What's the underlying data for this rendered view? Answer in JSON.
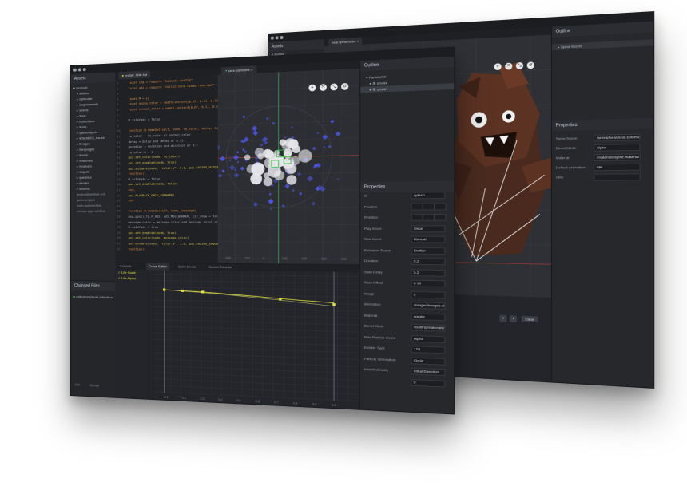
{
  "back_window": {
    "assets_title": "Assets",
    "tree": [
      "▾ /builtins"
    ],
    "tab": "bear.spinemodel",
    "outline_title": "Outline",
    "outline_item": "Spine Model",
    "properties_title": "Properties",
    "props": [
      {
        "label": "Spine Scene",
        "value": "/anims/bear/bear.spinescene"
      },
      {
        "label": "Blend Mode",
        "value": "Alpha"
      },
      {
        "label": "Material",
        "value": "/materials/spine.material"
      },
      {
        "label": "Default Animation",
        "value": "idle"
      },
      {
        "label": "Skin",
        "value": ""
      }
    ],
    "clear_label": "Clear"
  },
  "front_window": {
    "assets_title": "Assets",
    "tree": [
      "▾ /android",
      "▾ /builtins",
      "▸ /defender",
      "▸ /engineassets",
      "▸ /anims",
      "▸ /bear",
      "▸ /collections",
      "▸ /fonts",
      "▸ /gameobjects",
      "▸ /ENEMIES_house",
      "▸ /images",
      "▸ /languages",
      "▸ /levels",
      "▸ /materials",
      "▸ /modules",
      "▸ /objects",
      "▸ /particles",
      "▸ /render",
      "▸ /sounds",
      "AndroidManifest.xml",
      "game.project",
      "main.appmanifest",
      "release.appmanifest"
    ],
    "changed_files_title": "Changed Files",
    "changed_file": "collections/level.collection",
    "diff_label": "Diff",
    "revert_label": "Revert",
    "code_tab": "restart_hide.lua",
    "particle_tab": "take.particlefx",
    "code_lines": [
      "local cfg = require \"modules.config\"",
      "local ads = require \"collections.loader.ads.api\"",
      "",
      "local M = {}",
      "local alpha_color = vmath.vector4(0.67, 0.11, 0.12, 1)",
      "local normal_color = vmath.vector4(0.67, 0.11, 0.12, 1)",
      "",
      "M.isInFade = false",
      "",
      "function M.fadeOut(self, node, to_color, delay, duration)",
      "  to_color = to_color or normal_color",
      "  delay = delay and delay or 0.15",
      "  duration = duration and duration or 0.1",
      "  to_color.w = 1",
      "  gui.set_color(node, to_color)",
      "  gui.set_enabled(node, true)",
      "  gui.animate(node, \"color.w\", 0.0, gui.EASING_OUTQUAD,",
      "    function()",
      "      M.isInFade = false",
      "      gui.set_enabled(node, false)",
      "    end,",
      "  gui.PLAYBACK_ONCE_FORWARD)",
      "end",
      "",
      "function M.fadeIn(self, node, message)",
      "  msg.post(cfg.P_ADS, ads.MSG_BANNER, {is_show = false})",
      "  message.color = message.color and message.color or normal_color",
      "  M.isInFade = true",
      "  gui.set_enabled(node, true)",
      "  gui.set_color(node, message.color)",
      "  gui.animate(node, \"color.w\", 1.0, gui.EASING_INQUAD,",
      "    function()"
    ],
    "outline_title": "Outline",
    "outline_items": [
      "▾ ParticleFX",
      "▸ ⊞ smoke",
      "▸ ⊞ splash"
    ],
    "properties_title": "Properties",
    "props": [
      {
        "label": "Id",
        "value": "splash"
      },
      {
        "label": "Position",
        "value": ""
      },
      {
        "label": "Rotation",
        "value": ""
      },
      {
        "label": "Play Mode",
        "value": "Once"
      },
      {
        "label": "Size Mode",
        "value": "Manual"
      },
      {
        "label": "Emission Space",
        "value": "Emitter"
      },
      {
        "label": "Duration",
        "value": "0.2"
      },
      {
        "label": "Start Delay",
        "value": "0.2"
      },
      {
        "label": "Start Offset",
        "value": "0.15"
      },
      {
        "label": "Image",
        "value": "0"
      },
      {
        "label": "Animation",
        "value": "/images/images.atlas"
      },
      {
        "label": "Material",
        "value": "smoke"
      },
      {
        "label": "Blend Mode",
        "value": "/builtins/materials/particlefx.material"
      },
      {
        "label": "Max Particle Count",
        "value": "Alpha"
      },
      {
        "label": "Emitter Type",
        "value": "128"
      },
      {
        "label": "Particle Orientation",
        "value": "Circle"
      },
      {
        "label": "Inherit Velocity",
        "value": "Initial Direction"
      },
      {
        "label": "",
        "value": "0"
      }
    ],
    "bottom_tabs": [
      "Console",
      "Curve Editor",
      "Build Errors",
      "Search Results"
    ],
    "curve_items": [
      "Life Scale",
      "Life Alpha"
    ],
    "curve_ticks": [
      "0.1",
      "0.2",
      "0.3",
      "0.4",
      "0.5",
      "0.6",
      "0.7",
      "0.8",
      "0.9",
      "1.0"
    ],
    "viewport_ticks": [
      "-200",
      "-100",
      "0",
      "100",
      "200",
      "300",
      "400"
    ]
  },
  "colors": {
    "accent": "#e4e33a",
    "selection": "#3a3d44",
    "particles_blue": "#4c56e6",
    "green_axis": "#3ac24a",
    "red_axis": "#c8402c"
  }
}
